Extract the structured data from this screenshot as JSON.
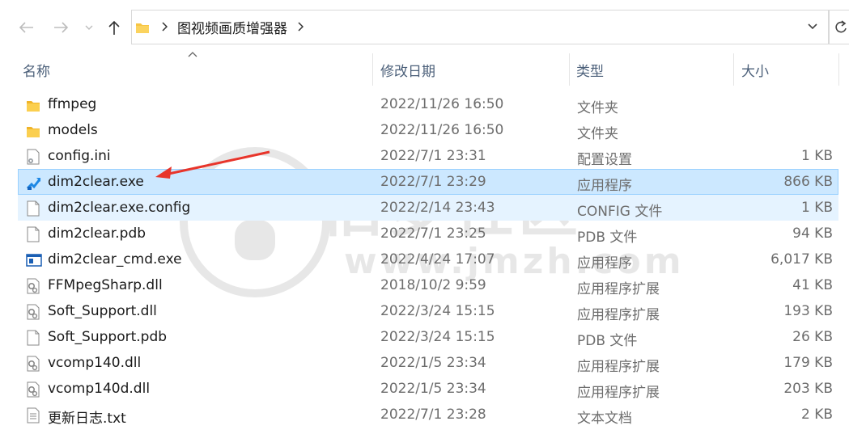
{
  "navigation": {
    "back_icon": "arrow-left-icon",
    "forward_icon": "arrow-right-icon",
    "recent_icon": "chevron-down-icon",
    "up_icon": "arrow-up-icon",
    "breadcrumb": [
      "图视频画质增强器"
    ],
    "refresh_icon": "refresh-icon"
  },
  "columns": {
    "name": "名称",
    "date": "修改日期",
    "type": "类型",
    "size": "大小"
  },
  "files": [
    {
      "name": "ffmpeg",
      "date": "2022/11/26 16:50",
      "type": "文件夹",
      "size": "",
      "icon": "folder-icon"
    },
    {
      "name": "models",
      "date": "2022/11/26 16:50",
      "type": "文件夹",
      "size": "",
      "icon": "folder-icon"
    },
    {
      "name": "config.ini",
      "date": "2022/7/1 23:31",
      "type": "配置设置",
      "size": "1 KB",
      "icon": "ini-file-icon"
    },
    {
      "name": "dim2clear.exe",
      "date": "2022/7/1 23:29",
      "type": "应用程序",
      "size": "866 KB",
      "icon": "app-icon",
      "state": "selected"
    },
    {
      "name": "dim2clear.exe.config",
      "date": "2022/2/14 23:43",
      "type": "CONFIG 文件",
      "size": "1 KB",
      "icon": "file-icon",
      "state": "hovered"
    },
    {
      "name": "dim2clear.pdb",
      "date": "2022/7/1 23:25",
      "type": "PDB 文件",
      "size": "94 KB",
      "icon": "file-icon"
    },
    {
      "name": "dim2clear_cmd.exe",
      "date": "2022/4/24 17:07",
      "type": "应用程序",
      "size": "6,017 KB",
      "icon": "exe-window-icon"
    },
    {
      "name": "FFMpegSharp.dll",
      "date": "2018/10/2 9:59",
      "type": "应用程序扩展",
      "size": "41 KB",
      "icon": "dll-file-icon"
    },
    {
      "name": "Soft_Support.dll",
      "date": "2022/3/24 15:15",
      "type": "应用程序扩展",
      "size": "193 KB",
      "icon": "dll-file-icon"
    },
    {
      "name": "Soft_Support.pdb",
      "date": "2022/3/24 15:15",
      "type": "PDB 文件",
      "size": "26 KB",
      "icon": "file-icon"
    },
    {
      "name": "vcomp140.dll",
      "date": "2022/1/5 23:34",
      "type": "应用程序扩展",
      "size": "179 KB",
      "icon": "dll-file-icon"
    },
    {
      "name": "vcomp140d.dll",
      "date": "2022/1/5 23:34",
      "type": "应用程序扩展",
      "size": "203 KB",
      "icon": "dll-file-icon"
    },
    {
      "name": "更新日志.txt",
      "date": "2022/7/1 23:28",
      "type": "文本文档",
      "size": "2 KB",
      "icon": "text-file-icon"
    }
  ],
  "watermark": {
    "text": "旧梦社区",
    "url": "www.jmzh.com"
  },
  "colors": {
    "selected_bg": "#cce8ff",
    "selected_border": "#99d1ff",
    "hover_bg": "#e5f3ff",
    "header_text": "#4c607a",
    "annotation_arrow": "#e8352b",
    "folder": "#f7c544"
  }
}
